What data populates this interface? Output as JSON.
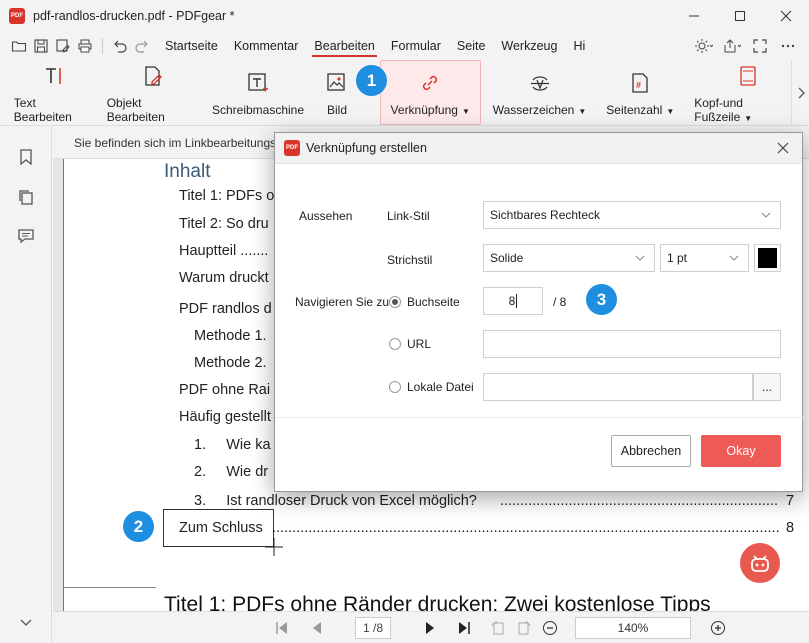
{
  "window": {
    "title": "pdf-randlos-drucken.pdf - PDFgear *",
    "logo_text": "PDF"
  },
  "menu": {
    "items": [
      "Startseite",
      "Kommentar",
      "Bearbeiten",
      "Formular",
      "Seite",
      "Werkzeug",
      "Hi"
    ],
    "active": "Bearbeiten"
  },
  "ribbon": {
    "items": [
      {
        "label": "Text Bearbeiten",
        "icon": "text-edit-icon"
      },
      {
        "label": "Objekt Bearbeiten",
        "icon": "object-edit-icon"
      },
      {
        "label": "Schreibmaschine",
        "icon": "typewriter-icon"
      },
      {
        "label": "Bild",
        "icon": "image-icon"
      },
      {
        "label": "Verknüpfung",
        "icon": "link-icon",
        "dropdown": true
      },
      {
        "label": "Wasserzeichen",
        "icon": "watermark-icon",
        "dropdown": true
      },
      {
        "label": "Seitenzahl",
        "icon": "page-number-icon",
        "dropdown": true
      },
      {
        "label": "Kopf-und Fußzeile",
        "icon": "header-footer-icon",
        "dropdown": true
      }
    ]
  },
  "banner": {
    "text": "Sie befinden sich im Linkbearbeitungs"
  },
  "document": {
    "toc_heading": "Inhalt",
    "toc": [
      {
        "text": "Titel 1: PDFs o",
        "page": ""
      },
      {
        "text": "Titel 2: So dru",
        "page": ""
      },
      {
        "text": "Hauptteil .......",
        "page": ""
      },
      {
        "text": "Warum druckt",
        "page": ""
      },
      {
        "text": "PDF randlos d",
        "page": ""
      },
      {
        "text": "Methode 1.",
        "page": ""
      },
      {
        "text": "Methode 2.",
        "page": ""
      },
      {
        "text": "PDF ohne Rai",
        "page": ""
      },
      {
        "text": "Häufig gestellt",
        "page": ""
      },
      {
        "text": "1.     Wie ka",
        "page": ""
      },
      {
        "text": "2.     Wie dr",
        "page": ""
      },
      {
        "text": "3.     Ist randloser Druck von Excel möglich? ",
        "page": "7"
      },
      {
        "text": "Zum Schluss",
        "page": "8"
      }
    ],
    "big_title": "Titel 1: PDFs ohne Ränder drucken: Zwei kostenlose Tipps"
  },
  "badges": [
    "1",
    "2",
    "3"
  ],
  "dialog": {
    "title": "Verknüpfung erstellen",
    "appearance_label": "Aussehen",
    "link_style_label": "Link-Stil",
    "link_style_value": "Sichtbares Rechteck",
    "stroke_label": "Strichstil",
    "stroke_value": "Solide",
    "stroke_width_value": "1 pt",
    "stroke_color": "#000000",
    "navigate_label": "Navigieren Sie zu",
    "option_page": "Buchseite",
    "page_value": "8",
    "page_total": "/ 8",
    "option_url": "URL",
    "url_value": "",
    "option_file": "Lokale Datei",
    "file_value": "",
    "browse_label": "...",
    "cancel_label": "Abbrechen",
    "ok_label": "Okay"
  },
  "bottombar": {
    "page_indicator": "1 /8",
    "zoom": "140%"
  },
  "colors": {
    "accent": "#d9342b",
    "badge": "#1e8ee0",
    "ok_button": "#ee5b56"
  }
}
